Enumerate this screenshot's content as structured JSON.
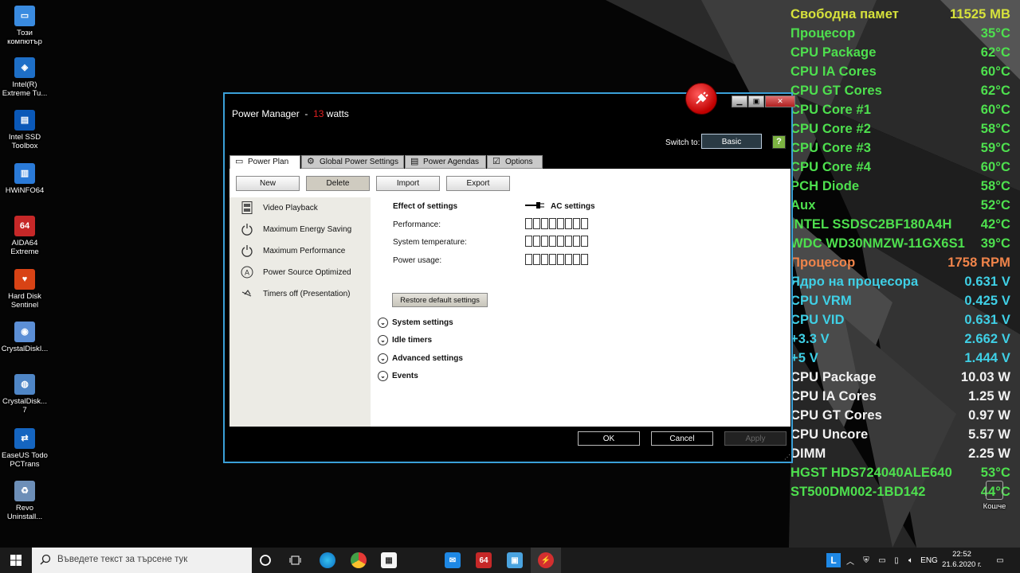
{
  "desktop": {
    "icons": [
      {
        "label": "Този компютър",
        "color": "#3a8be0",
        "glyph": "▭"
      },
      {
        "label": "Intel(R) Extreme Tu...",
        "color": "#1e6fc7",
        "glyph": "◈"
      },
      {
        "label": "Intel SSD Toolbox",
        "color": "#0a58b8",
        "glyph": "▤"
      },
      {
        "label": "HWiNFO64",
        "color": "#2a7ad8",
        "glyph": "▥"
      },
      {
        "label": "AIDA64 Extreme",
        "color": "#c62828",
        "glyph": "64"
      },
      {
        "label": "Hard Disk Sentinel",
        "color": "#d84315",
        "glyph": "♥"
      },
      {
        "label": "CrystalDiskI...",
        "color": "#5c8fd6",
        "glyph": "◉"
      },
      {
        "label": "CrystalDisk... 7",
        "color": "#4f86c6",
        "glyph": "◍"
      },
      {
        "label": "EaseUS Todo PCTrans",
        "color": "#1565c0",
        "glyph": "⇄"
      },
      {
        "label": "Revo Uninstall...",
        "color": "#6d8fb8",
        "glyph": "♻"
      }
    ],
    "recycle_bin": {
      "label": "Кошче"
    }
  },
  "sensors": [
    {
      "label": "Свободна памет",
      "value": "11525 MB",
      "color": "#d7e23b"
    },
    {
      "label": "Процесор",
      "value": "35°C",
      "color": "#4ee04e"
    },
    {
      "label": "CPU Package",
      "value": "62°C",
      "color": "#4ee04e"
    },
    {
      "label": "CPU IA Cores",
      "value": "60°C",
      "color": "#4ee04e"
    },
    {
      "label": "CPU GT Cores",
      "value": "62°C",
      "color": "#4ee04e"
    },
    {
      "label": "CPU Core #1",
      "value": "60°C",
      "color": "#4ee04e"
    },
    {
      "label": "CPU Core #2",
      "value": "58°C",
      "color": "#4ee04e"
    },
    {
      "label": "CPU Core #3",
      "value": "59°C",
      "color": "#4ee04e"
    },
    {
      "label": "CPU Core #4",
      "value": "60°C",
      "color": "#4ee04e"
    },
    {
      "label": "PCH Diode",
      "value": "58°C",
      "color": "#4ee04e"
    },
    {
      "label": "Aux",
      "value": "52°C",
      "color": "#4ee04e"
    },
    {
      "label": "INTEL SSDSC2BF180A4H",
      "value": "42°C",
      "color": "#4ee04e"
    },
    {
      "label": "WDC WD30NMZW-11GX6S1",
      "value": "39°C",
      "color": "#4ee04e"
    },
    {
      "label": "Процесор",
      "value": "1758 RPM",
      "color": "#f0844a"
    },
    {
      "label": "Ядро на процесора",
      "value": "0.631 V",
      "color": "#3fd0e6"
    },
    {
      "label": "CPU VRM",
      "value": "0.425 V",
      "color": "#3fd0e6"
    },
    {
      "label": "CPU VID",
      "value": "0.631 V",
      "color": "#3fd0e6"
    },
    {
      "label": "+3.3 V",
      "value": "2.662 V",
      "color": "#3fd0e6"
    },
    {
      "label": "+5 V",
      "value": "1.444 V",
      "color": "#3fd0e6"
    },
    {
      "label": "CPU Package",
      "value": "10.03 W",
      "color": "#f2f2f2"
    },
    {
      "label": "CPU IA Cores",
      "value": "1.25 W",
      "color": "#f2f2f2"
    },
    {
      "label": "CPU GT Cores",
      "value": "0.97 W",
      "color": "#f2f2f2"
    },
    {
      "label": "CPU Uncore",
      "value": "5.57 W",
      "color": "#f2f2f2"
    },
    {
      "label": "DIMM",
      "value": "2.25 W",
      "color": "#f2f2f2"
    },
    {
      "label": "HGST HDS724040ALE640",
      "value": "53°C",
      "color": "#4ee04e"
    },
    {
      "label": "ST500DM002-1BD142",
      "value": "44°C",
      "color": "#4ee04e"
    }
  ],
  "window": {
    "title": "Power Manager",
    "title_sep": "-",
    "watts": "13",
    "watts_unit": "watts",
    "switch_label": "Switch to:",
    "switch_button": "Basic",
    "help_icon": "?",
    "tabs": [
      {
        "label": "Power Plan",
        "icon": "plan-icon"
      },
      {
        "label": "Global Power Settings",
        "icon": "gear-icon"
      },
      {
        "label": "Power Agendas",
        "icon": "agenda-icon"
      },
      {
        "label": "Options",
        "icon": "checkbox-icon"
      }
    ],
    "toolbar": {
      "new": "New",
      "delete": "Delete",
      "import": "Import",
      "export": "Export"
    },
    "plans": [
      {
        "label": "Video Playback",
        "icon": "film-icon"
      },
      {
        "label": "Maximum Energy Saving",
        "icon": "power-icon"
      },
      {
        "label": "Maximum Performance",
        "icon": "power-icon"
      },
      {
        "label": "Power Source Optimized",
        "icon": "auto-icon"
      },
      {
        "label": "Timers off (Presentation)",
        "icon": "presentation-icon"
      }
    ],
    "effect": {
      "heading": "Effect of settings",
      "ac_label": "AC settings",
      "performance": "Performance:",
      "temperature": "System temperature:",
      "power_usage": "Power usage:"
    },
    "restore_button": "Restore default settings",
    "sections": [
      "System settings",
      "Idle timers",
      "Advanced settings",
      "Events"
    ],
    "ok": "OK",
    "cancel": "Cancel",
    "apply": "Apply"
  },
  "taskbar": {
    "search_placeholder": "Въведете текст за търсене тук",
    "language": "ENG",
    "time": "22:52",
    "date": "21.6.2020 г.",
    "aida_badge": "64",
    "tray_badge": "L"
  }
}
